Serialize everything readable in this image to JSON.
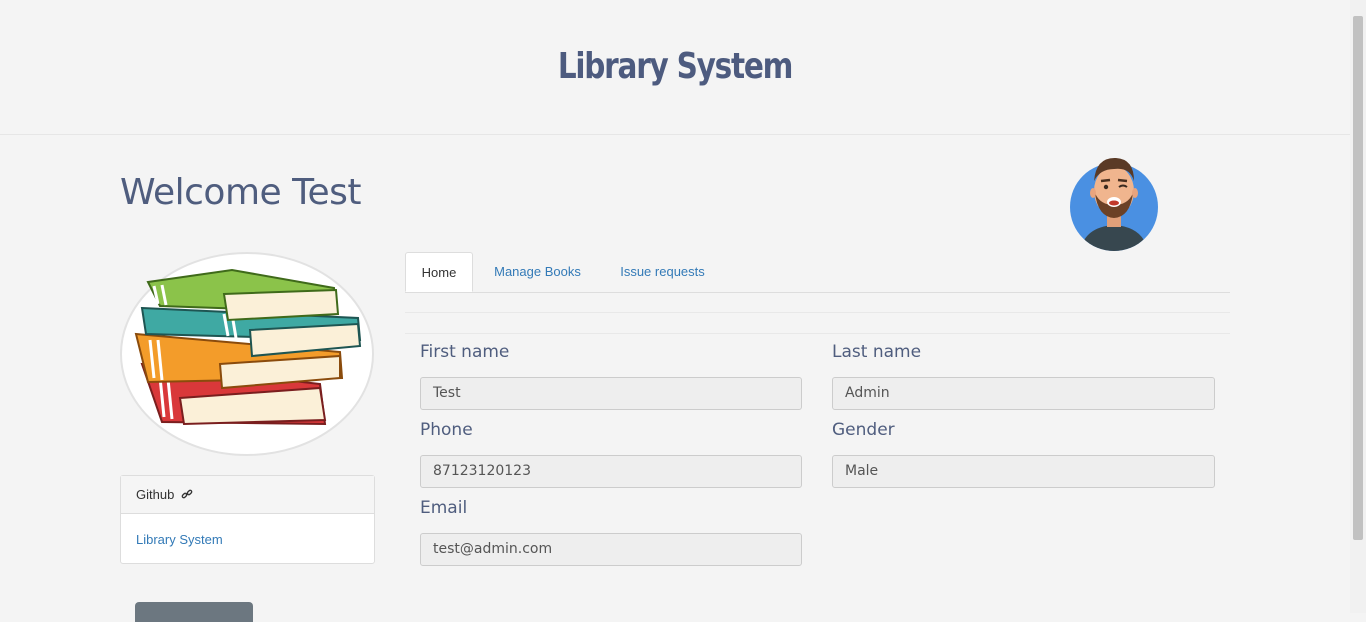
{
  "header": {
    "title": "Library System"
  },
  "welcome": {
    "text": "Welcome Test"
  },
  "github_card": {
    "heading": "Github",
    "link_icon": "link-icon",
    "link_label": "Library System"
  },
  "tabs": [
    {
      "label": "Home",
      "active": true
    },
    {
      "label": "Manage Books",
      "active": false
    },
    {
      "label": "Issue requests",
      "active": false
    }
  ],
  "profile": {
    "first_name_label": "First name",
    "first_name_value": "Test",
    "last_name_label": "Last name",
    "last_name_value": "Admin",
    "phone_label": "Phone",
    "phone_value": "87123120123",
    "gender_label": "Gender",
    "gender_value": "Male",
    "email_label": "Email",
    "email_value": "test@admin.com"
  },
  "colors": {
    "title": "#4d5b7f",
    "link": "#337ab7",
    "avatar_bg": "#4a90e2"
  }
}
